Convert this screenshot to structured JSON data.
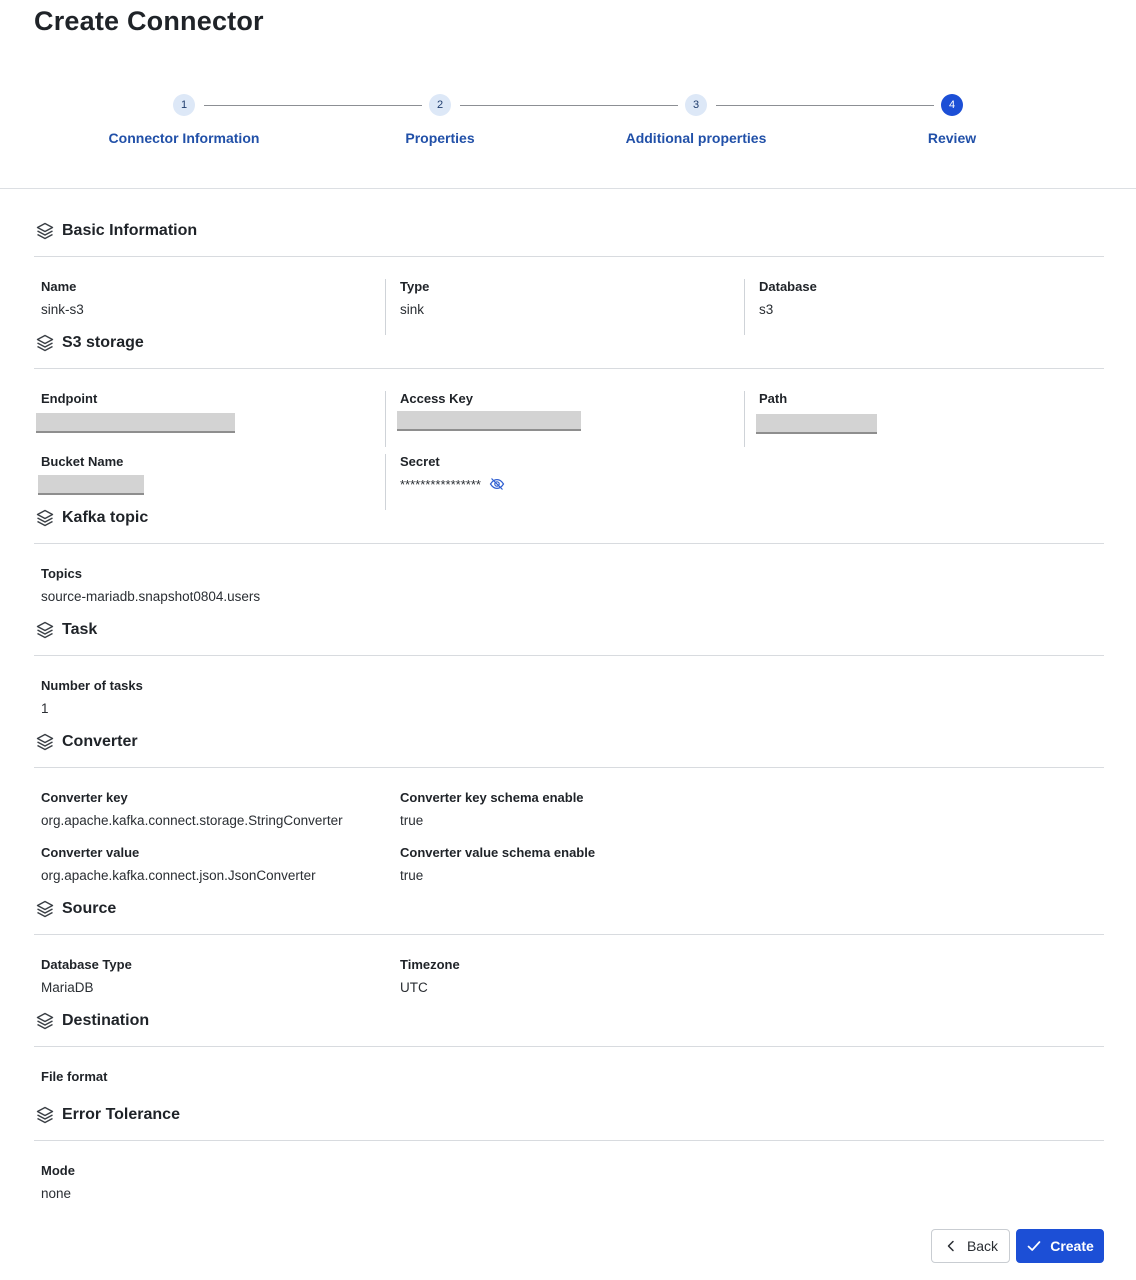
{
  "page": {
    "title": "Create Connector"
  },
  "stepper": {
    "steps": [
      {
        "number": "1",
        "label": "Connector Information",
        "active": false
      },
      {
        "number": "2",
        "label": "Properties",
        "active": false
      },
      {
        "number": "3",
        "label": "Additional properties",
        "active": false
      },
      {
        "number": "4",
        "label": "Review",
        "active": true
      }
    ]
  },
  "sections": {
    "basic": {
      "title": "Basic Information",
      "name_label": "Name",
      "name_value": "sink-s3",
      "type_label": "Type",
      "type_value": "sink",
      "database_label": "Database",
      "database_value": "s3"
    },
    "s3": {
      "title": "S3 storage",
      "endpoint_label": "Endpoint",
      "access_key_label": "Access Key",
      "path_label": "Path",
      "bucket_label": "Bucket Name",
      "secret_label": "Secret",
      "secret_value": "****************"
    },
    "kafka": {
      "title": "Kafka topic",
      "topics_label": "Topics",
      "topics_value": "source-mariadb.snapshot0804.users"
    },
    "task": {
      "title": "Task",
      "tasks_label": "Number of tasks",
      "tasks_value": "1"
    },
    "converter": {
      "title": "Converter",
      "key_label": "Converter key",
      "key_value": "org.apache.kafka.connect.storage.StringConverter",
      "key_schema_label": "Converter key schema enable",
      "key_schema_value": "true",
      "value_label": "Converter value",
      "value_value": "org.apache.kafka.connect.json.JsonConverter",
      "value_schema_label": "Converter value schema enable",
      "value_schema_value": "true"
    },
    "source": {
      "title": "Source",
      "dbtype_label": "Database Type",
      "dbtype_value": "MariaDB",
      "timezone_label": "Timezone",
      "timezone_value": "UTC"
    },
    "destination": {
      "title": "Destination",
      "format_label": "File format"
    },
    "error": {
      "title": "Error Tolerance",
      "mode_label": "Mode",
      "mode_value": "none"
    }
  },
  "actions": {
    "back_label": "Back",
    "create_label": "Create"
  },
  "colors": {
    "primary": "#1c4fd6",
    "step_text": "#2150a8",
    "step_circle": "#dde8f7"
  },
  "icons": {
    "section": "layers-icon",
    "secret_toggle": "eye-off-icon",
    "back": "chevron-left-icon",
    "create": "check-icon"
  }
}
